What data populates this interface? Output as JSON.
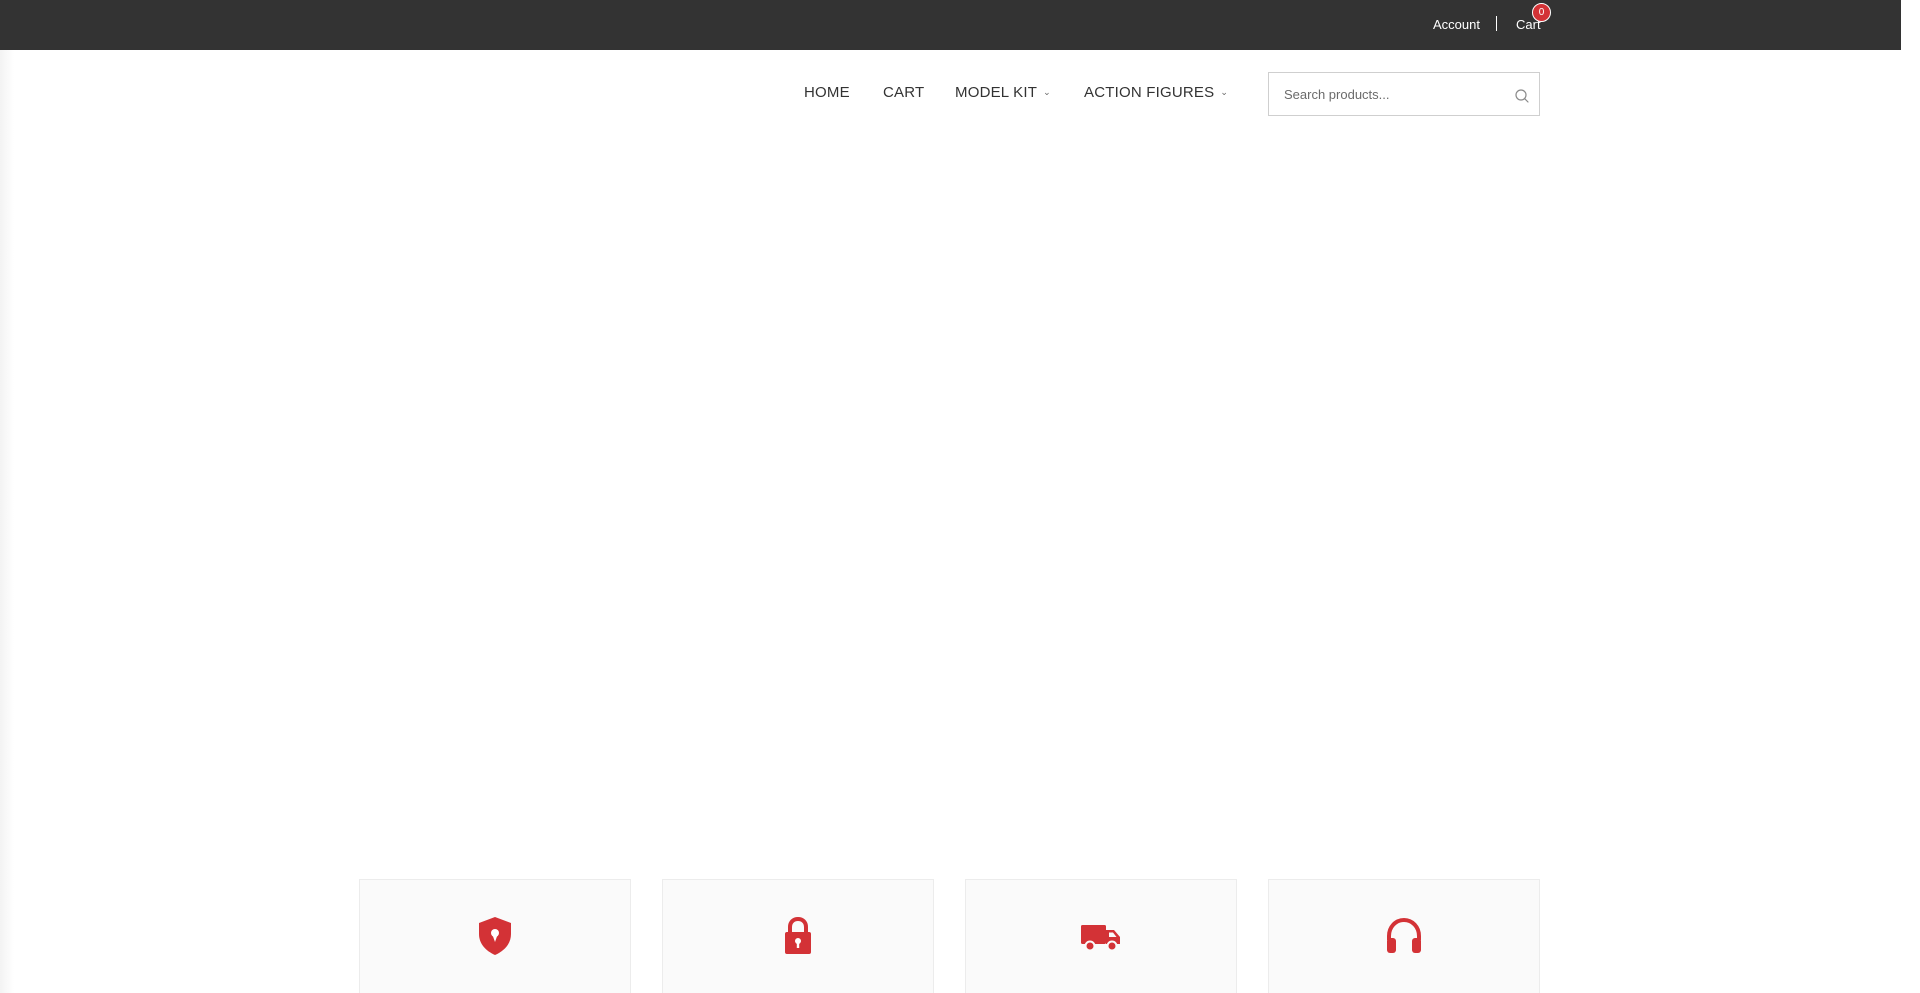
{
  "topbar": {
    "account_label": "Account",
    "cart_label": "Cart",
    "cart_count": "0"
  },
  "nav": {
    "items": [
      {
        "label": "HOME"
      },
      {
        "label": "CART"
      },
      {
        "label": "MODEL KIT",
        "has_dropdown": true
      },
      {
        "label": "ACTION FIGURES",
        "has_dropdown": true
      }
    ]
  },
  "search": {
    "placeholder": "Search products...",
    "value": ""
  },
  "features": [
    {
      "icon": "shield-icon"
    },
    {
      "icon": "lock-icon"
    },
    {
      "icon": "truck-icon"
    },
    {
      "icon": "headphones-icon"
    }
  ],
  "colors": {
    "topbar_bg": "#333333",
    "accent": "#d33236",
    "text": "#333333"
  }
}
